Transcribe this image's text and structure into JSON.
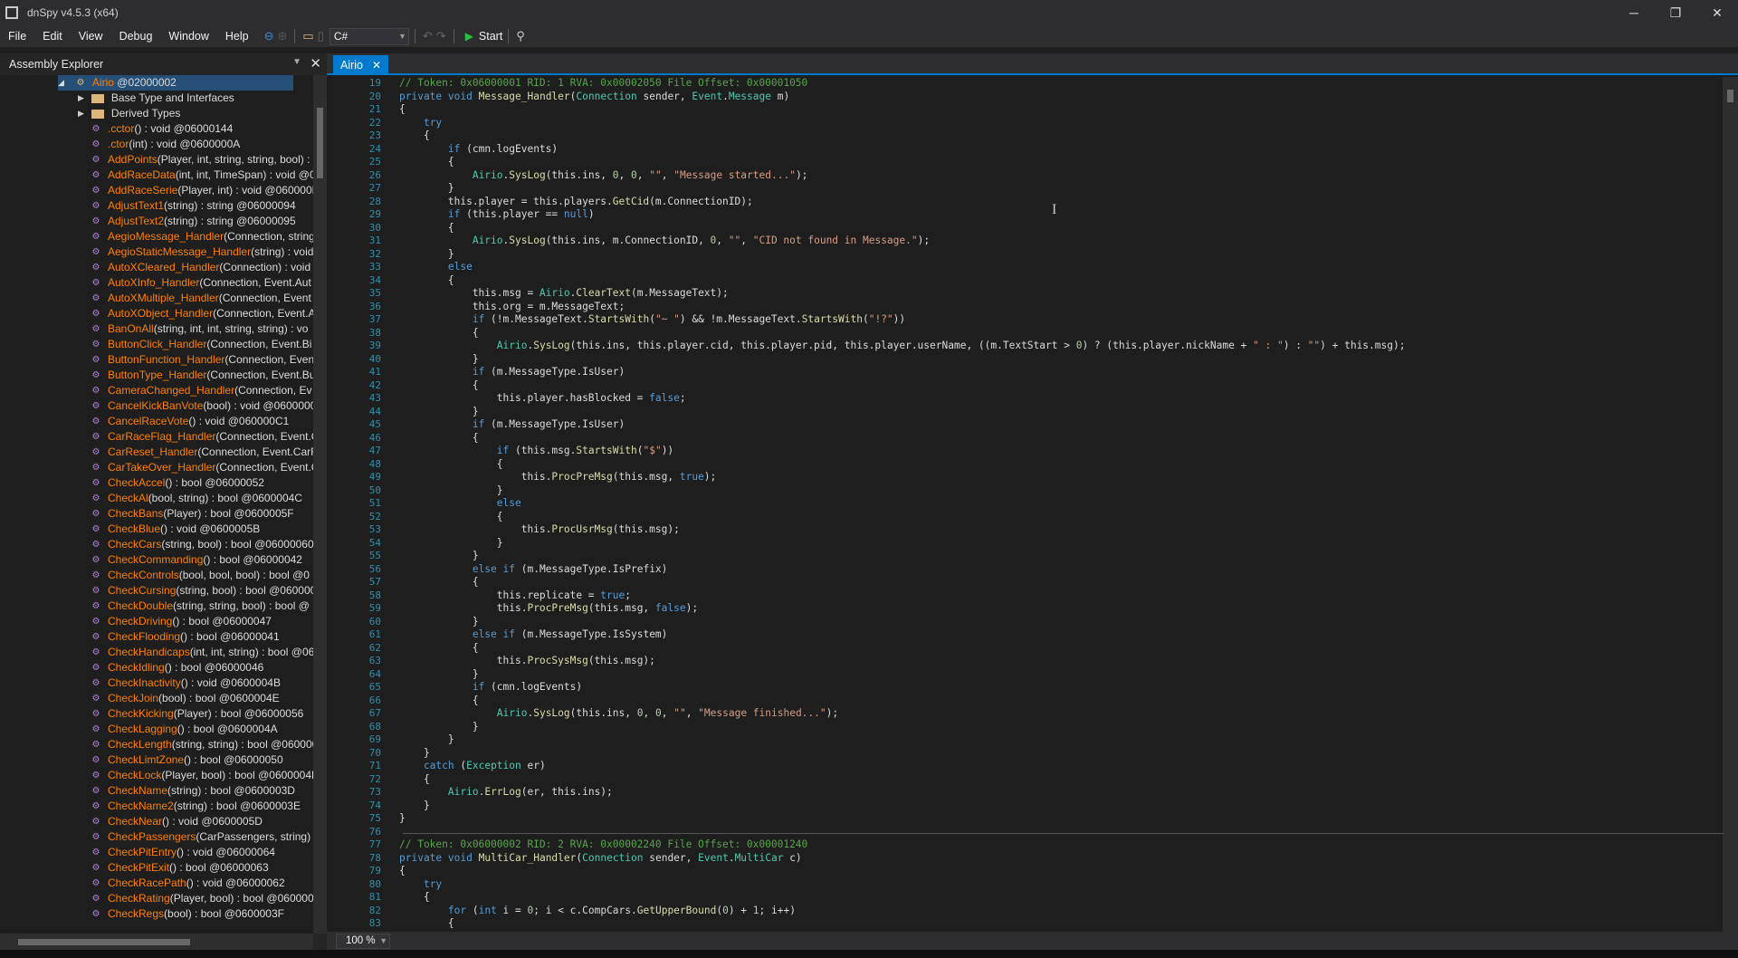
{
  "window": {
    "title": "dnSpy v4.5.3 (x64)",
    "minimize": "─",
    "maximize": "❐",
    "close": "✕"
  },
  "menu": {
    "items": [
      "File",
      "Edit",
      "View",
      "Debug",
      "Window",
      "Help"
    ]
  },
  "toolbar": {
    "language": "C#",
    "start_label": "Start"
  },
  "assembly_explorer": {
    "title": "Assembly Explorer",
    "root": {
      "name": "Airio",
      "meta": "@02000002"
    },
    "folders": [
      "Base Type and Interfaces",
      "Derived Types"
    ],
    "members": [
      {
        "name": ".cctor",
        "sig": "() : void @06000144"
      },
      {
        "name": ".ctor",
        "sig": "(int) : void @0600000A"
      },
      {
        "name": "AddPoints",
        "sig": "(Player, int, string, string, bool) :"
      },
      {
        "name": "AddRaceData",
        "sig": "(int, int, TimeSpan) : void @0"
      },
      {
        "name": "AddRaceSerie",
        "sig": "(Player, int) : void @060000EI"
      },
      {
        "name": "AdjustText1",
        "sig": "(string) : string @06000094"
      },
      {
        "name": "AdjustText2",
        "sig": "(string) : string @06000095"
      },
      {
        "name": "AegioMessage_Handler",
        "sig": "(Connection, string"
      },
      {
        "name": "AegioStaticMessage_Handler",
        "sig": "(string) : void"
      },
      {
        "name": "AutoXCleared_Handler",
        "sig": "(Connection) : void"
      },
      {
        "name": "AutoXInfo_Handler",
        "sig": "(Connection, Event.Aut"
      },
      {
        "name": "AutoXMultiple_Handler",
        "sig": "(Connection, Event"
      },
      {
        "name": "AutoXObject_Handler",
        "sig": "(Connection, Event.A"
      },
      {
        "name": "BanOnAll",
        "sig": "(string, int, int, string, string) : vo"
      },
      {
        "name": "ButtonClick_Handler",
        "sig": "(Connection, Event.Bi"
      },
      {
        "name": "ButtonFunction_Handler",
        "sig": "(Connection, Even"
      },
      {
        "name": "ButtonType_Handler",
        "sig": "(Connection, Event.Bu"
      },
      {
        "name": "CameraChanged_Handler",
        "sig": "(Connection, Ev"
      },
      {
        "name": "CancelKickBanVote",
        "sig": "(bool) : void @0600000C"
      },
      {
        "name": "CancelRaceVote",
        "sig": "() : void @060000C1"
      },
      {
        "name": "CarRaceFlag_Handler",
        "sig": "(Connection, Event.C"
      },
      {
        "name": "CarReset_Handler",
        "sig": "(Connection, Event.CarR"
      },
      {
        "name": "CarTakeOver_Handler",
        "sig": "(Connection, Event.C"
      },
      {
        "name": "CheckAccel",
        "sig": "() : bool @06000052"
      },
      {
        "name": "CheckAl",
        "sig": "(bool, string) : bool @0600004C"
      },
      {
        "name": "CheckBans",
        "sig": "(Player) : bool @0600005F"
      },
      {
        "name": "CheckBlue",
        "sig": "() : void @0600005B"
      },
      {
        "name": "CheckCars",
        "sig": "(string, bool) : bool @06000060"
      },
      {
        "name": "CheckCommanding",
        "sig": "() : bool @06000042"
      },
      {
        "name": "CheckControls",
        "sig": "(bool, bool, bool) : bool @0"
      },
      {
        "name": "CheckCursing",
        "sig": "(string, bool) : bool @060000"
      },
      {
        "name": "CheckDouble",
        "sig": "(string, string, bool) : bool @"
      },
      {
        "name": "CheckDriving",
        "sig": "() : bool @06000047"
      },
      {
        "name": "CheckFlooding",
        "sig": "() : bool @06000041"
      },
      {
        "name": "CheckHandicaps",
        "sig": "(int, int, string) : bool @06"
      },
      {
        "name": "CheckIdling",
        "sig": "() : bool @06000046"
      },
      {
        "name": "CheckInactivity",
        "sig": "() : void @0600004B"
      },
      {
        "name": "CheckJoin",
        "sig": "(bool) : bool @0600004E"
      },
      {
        "name": "CheckKicking",
        "sig": "(Player) : bool @06000056"
      },
      {
        "name": "CheckLagging",
        "sig": "() : bool @0600004A"
      },
      {
        "name": "CheckLength",
        "sig": "(string, string) : bool @060000"
      },
      {
        "name": "CheckLimtZone",
        "sig": "() : bool @06000050"
      },
      {
        "name": "CheckLock",
        "sig": "(Player, bool) : bool @0600004D"
      },
      {
        "name": "CheckName",
        "sig": "(string) : bool @0600003D"
      },
      {
        "name": "CheckName2",
        "sig": "(string) : bool @0600003E"
      },
      {
        "name": "CheckNear",
        "sig": "() : void @0600005D"
      },
      {
        "name": "CheckPassengers",
        "sig": "(CarPassengers, string) : I"
      },
      {
        "name": "CheckPitEntry",
        "sig": "() : void @06000064"
      },
      {
        "name": "CheckPitExit",
        "sig": "() : bool @06000063"
      },
      {
        "name": "CheckRacePath",
        "sig": "() : void @06000062"
      },
      {
        "name": "CheckRating",
        "sig": "(Player, bool) : bool @060000"
      },
      {
        "name": "CheckRegs",
        "sig": "(bool) : bool @0600003F"
      }
    ]
  },
  "editor": {
    "tab_label": "Airio",
    "zoom": "100 %",
    "lines": [
      {
        "n": "19",
        "text": "// Token: 0x06000001 RID: 1 RVA: 0x00002050 File Offset: 0x00001050"
      },
      {
        "n": "20",
        "text": "private void Message_Handler(Connection sender, Event.Message m)"
      },
      {
        "n": "21",
        "text": "{"
      },
      {
        "n": "22",
        "text": "    try"
      },
      {
        "n": "23",
        "text": "    {"
      },
      {
        "n": "24",
        "text": "        if (cmn.logEvents)"
      },
      {
        "n": "25",
        "text": "        {"
      },
      {
        "n": "26",
        "text": "            Airio.SysLog(this.ins, 0, 0, \"\", \"Message started...\");"
      },
      {
        "n": "27",
        "text": "        }"
      },
      {
        "n": "28",
        "text": "        this.player = this.players.GetCid(m.ConnectionID);"
      },
      {
        "n": "29",
        "text": "        if (this.player == null)"
      },
      {
        "n": "30",
        "text": "        {"
      },
      {
        "n": "31",
        "text": "            Airio.SysLog(this.ins, m.ConnectionID, 0, \"\", \"CID not found in Message.\");"
      },
      {
        "n": "32",
        "text": "        }"
      },
      {
        "n": "33",
        "text": "        else"
      },
      {
        "n": "34",
        "text": "        {"
      },
      {
        "n": "35",
        "text": "            this.msg = Airio.ClearText(m.MessageText);"
      },
      {
        "n": "36",
        "text": "            this.org = m.MessageText;"
      },
      {
        "n": "37",
        "text": "            if (!m.MessageText.StartsWith(\"~ \") && !m.MessageText.StartsWith(\"!?\"))"
      },
      {
        "n": "38",
        "text": "            {"
      },
      {
        "n": "39",
        "text": "                Airio.SysLog(this.ins, this.player.cid, this.player.pid, this.player.userName, ((m.TextStart > 0) ? (this.player.nickName + \" : \") : \"\") + this.msg);"
      },
      {
        "n": "40",
        "text": "            }"
      },
      {
        "n": "41",
        "text": "            if (m.MessageType.IsUser)"
      },
      {
        "n": "42",
        "text": "            {"
      },
      {
        "n": "43",
        "text": "                this.player.hasBlocked = false;"
      },
      {
        "n": "44",
        "text": "            }"
      },
      {
        "n": "45",
        "text": "            if (m.MessageType.IsUser)"
      },
      {
        "n": "46",
        "text": "            {"
      },
      {
        "n": "47",
        "text": "                if (this.msg.StartsWith(\"$\"))"
      },
      {
        "n": "48",
        "text": "                {"
      },
      {
        "n": "49",
        "text": "                    this.ProcPreMsg(this.msg, true);"
      },
      {
        "n": "50",
        "text": "                }"
      },
      {
        "n": "51",
        "text": "                else"
      },
      {
        "n": "52",
        "text": "                {"
      },
      {
        "n": "53",
        "text": "                    this.ProcUsrMsg(this.msg);"
      },
      {
        "n": "54",
        "text": "                }"
      },
      {
        "n": "55",
        "text": "            }"
      },
      {
        "n": "56",
        "text": "            else if (m.MessageType.IsPrefix)"
      },
      {
        "n": "57",
        "text": "            {"
      },
      {
        "n": "58",
        "text": "                this.replicate = true;"
      },
      {
        "n": "59",
        "text": "                this.ProcPreMsg(this.msg, false);"
      },
      {
        "n": "60",
        "text": "            }"
      },
      {
        "n": "61",
        "text": "            else if (m.MessageType.IsSystem)"
      },
      {
        "n": "62",
        "text": "            {"
      },
      {
        "n": "63",
        "text": "                this.ProcSysMsg(this.msg);"
      },
      {
        "n": "64",
        "text": "            }"
      },
      {
        "n": "65",
        "text": "            if (cmn.logEvents)"
      },
      {
        "n": "66",
        "text": "            {"
      },
      {
        "n": "67",
        "text": "                Airio.SysLog(this.ins, 0, 0, \"\", \"Message finished...\");"
      },
      {
        "n": "68",
        "text": "            }"
      },
      {
        "n": "69",
        "text": "        }"
      },
      {
        "n": "70",
        "text": "    }"
      },
      {
        "n": "71",
        "text": "    catch (Exception er)"
      },
      {
        "n": "72",
        "text": "    {"
      },
      {
        "n": "73",
        "text": "        Airio.ErrLog(er, this.ins);"
      },
      {
        "n": "74",
        "text": "    }"
      },
      {
        "n": "75",
        "text": "}"
      },
      {
        "n": "76",
        "text": ""
      },
      {
        "n": "77",
        "text": "// Token: 0x06000002 RID: 2 RVA: 0x00002240 File Offset: 0x00001240"
      },
      {
        "n": "78",
        "text": "private void MultiCar_Handler(Connection sender, Event.MultiCar c)"
      },
      {
        "n": "79",
        "text": "{"
      },
      {
        "n": "80",
        "text": "    try"
      },
      {
        "n": "81",
        "text": "    {"
      },
      {
        "n": "82",
        "text": "        for (int i = 0; i < c.CompCars.GetUpperBound(0) + 1; i++)"
      },
      {
        "n": "83",
        "text": "        {"
      }
    ]
  },
  "colors": {
    "accent": "#007acc",
    "keyword": "#569cd6",
    "type": "#4ec9b0",
    "method": "#dcdcaa",
    "string": "#d69d85",
    "comment": "#57a64a",
    "line_number": "#2b91af",
    "member": "#ff8000"
  },
  "icons": [
    "back-icon",
    "forward-icon",
    "open-icon",
    "undo-icon",
    "redo-icon",
    "play-icon",
    "search-icon",
    "folder-icon",
    "class-icon",
    "method-icon"
  ]
}
